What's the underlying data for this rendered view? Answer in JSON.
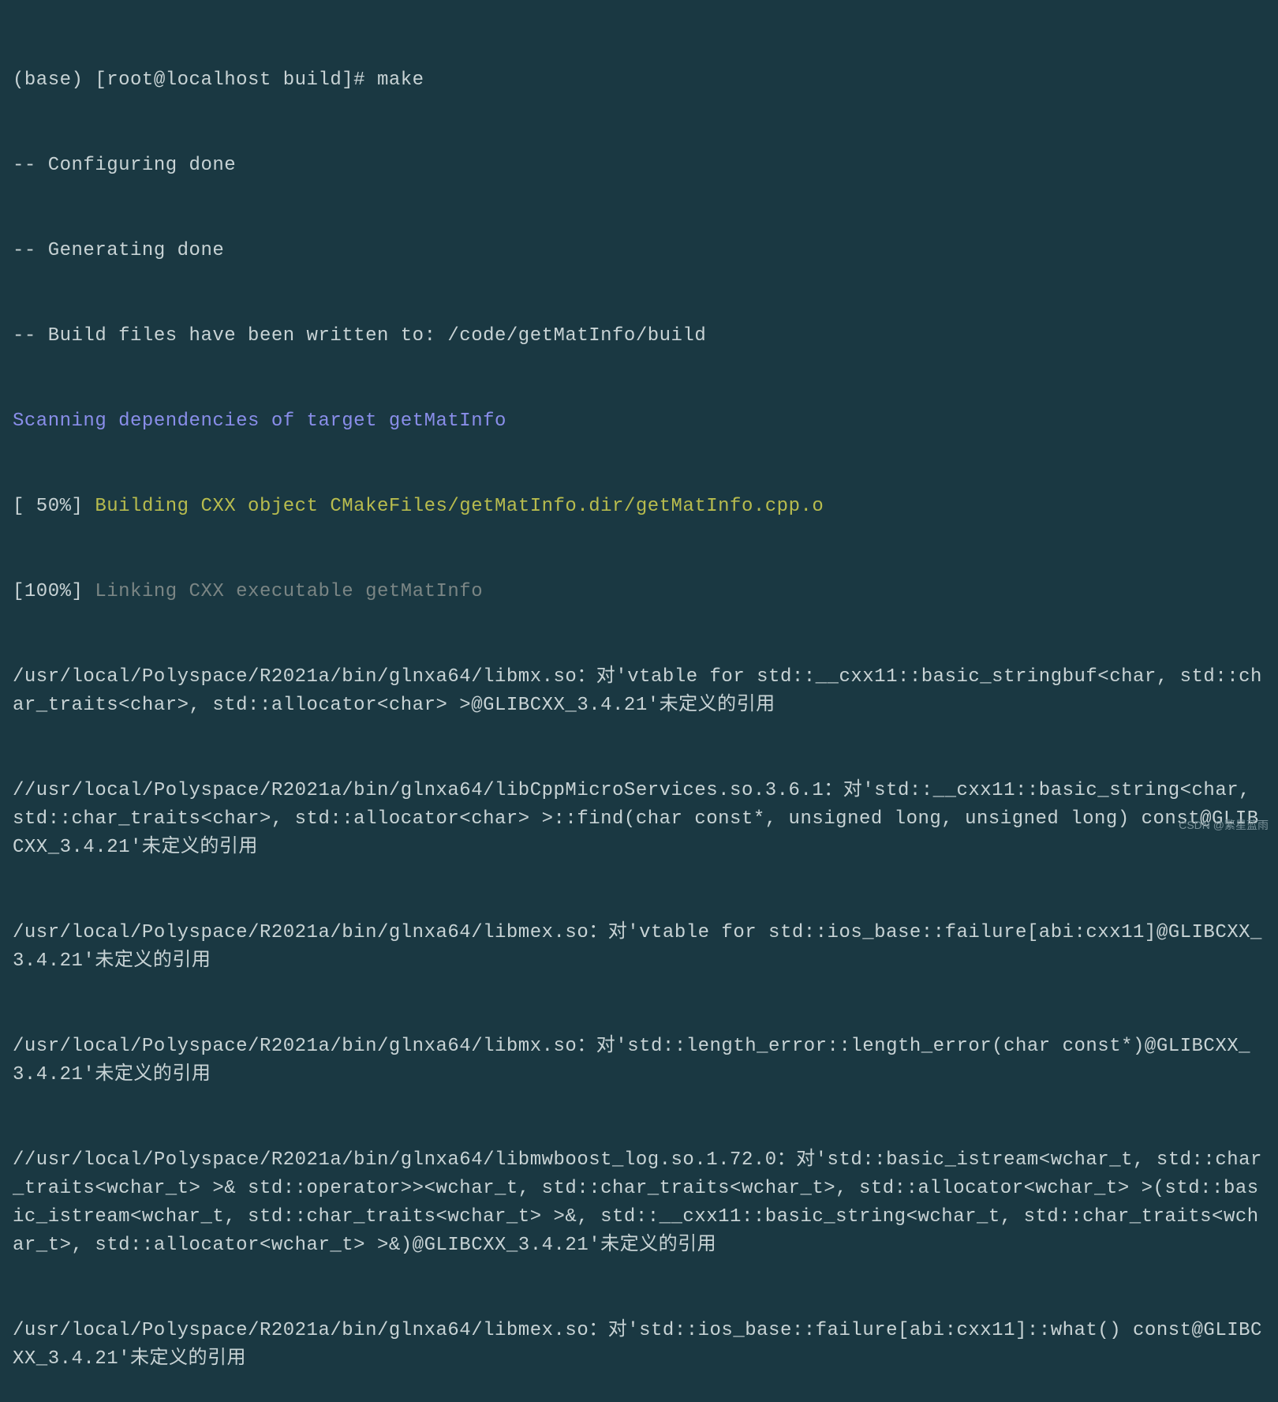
{
  "terminal": {
    "prompt": "(base) [root@localhost build]# make",
    "lines": [
      "-- Configuring done",
      "-- Generating done",
      "-- Build files have been written to: /code/getMatInfo/build"
    ],
    "scanning": "Scanning dependencies of target getMatInfo",
    "build50_prefix": "[ 50%] ",
    "build50_text": "Building CXX object CMakeFiles/getMatInfo.dir/getMatInfo.cpp.o",
    "link100_prefix": "[100%] ",
    "link100_text": "Linking CXX executable getMatInfo",
    "errors": [
      "/usr/local/Polyspace/R2021a/bin/glnxa64/libmx.so：对'vtable for std::__cxx11::basic_stringbuf<char, std::char_traits<char>, std::allocator<char> >@GLIBCXX_3.4.21'未定义的引用",
      "//usr/local/Polyspace/R2021a/bin/glnxa64/libCppMicroServices.so.3.6.1：对'std::__cxx11::basic_string<char, std::char_traits<char>, std::allocator<char> >::find(char const*, unsigned long, unsigned long) const@GLIBCXX_3.4.21'未定义的引用",
      "/usr/local/Polyspace/R2021a/bin/glnxa64/libmex.so：对'vtable for std::ios_base::failure[abi:cxx11]@GLIBCXX_3.4.21'未定义的引用",
      "/usr/local/Polyspace/R2021a/bin/glnxa64/libmx.so：对'std::length_error::length_error(char const*)@GLIBCXX_3.4.21'未定义的引用",
      "//usr/local/Polyspace/R2021a/bin/glnxa64/libmwboost_log.so.1.72.0：对'std::basic_istream<wchar_t, std::char_traits<wchar_t> >& std::operator>><wchar_t, std::char_traits<wchar_t>, std::allocator<wchar_t> >(std::basic_istream<wchar_t, std::char_traits<wchar_t> >&, std::__cxx11::basic_string<wchar_t, std::char_traits<wchar_t>, std::allocator<wchar_t> >&)@GLIBCXX_3.4.21'未定义的引用",
      "/usr/local/Polyspace/R2021a/bin/glnxa64/libmex.so：对'std::ios_base::failure[abi:cxx11]::what() const@GLIBCXX_3.4.21'未定义的引用"
    ]
  },
  "watermark": "CSDN @繁星蓝雨"
}
